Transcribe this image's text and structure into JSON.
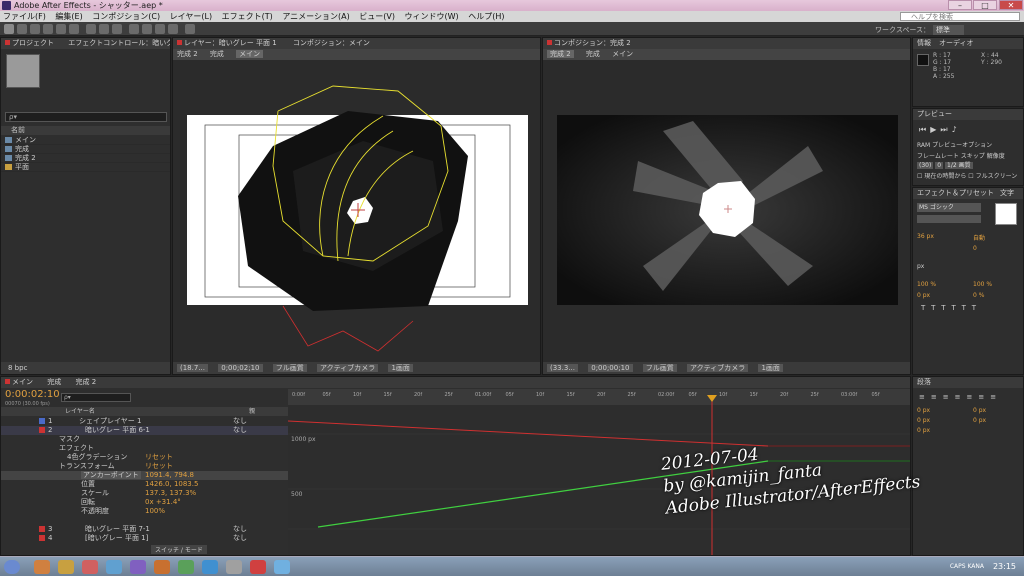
{
  "app": {
    "title": "Adobe After Effects - シャッター.aep *"
  },
  "window_controls": {
    "minimize": "–",
    "maximize": "□",
    "close": "✕"
  },
  "menu": [
    "ファイル(F)",
    "編集(E)",
    "コンポジション(C)",
    "レイヤー(L)",
    "エフェクト(T)",
    "アニメーション(A)",
    "ビュー(V)",
    "ウィンドウ(W)",
    "ヘルプ(H)"
  ],
  "search_help": {
    "placeholder": "ヘルプを検索"
  },
  "workspace": {
    "label": "ワークスペース：",
    "value": "標準"
  },
  "project_panel": {
    "tab_label": "プロジェクト",
    "effect_controls_tab": "エフェクトコントロール：暗いグレー",
    "search_placeholder": "ρ▾",
    "column_name": "名前",
    "items": [
      "メイン",
      "完成",
      "完成 2",
      "平面"
    ],
    "bpc": "8 bpc"
  },
  "layer_viewer": {
    "tab_label": "レイヤー：暗いグレー 平面 1",
    "comp_tab_label": "コンポジション：メイン",
    "breadcrumbs": [
      "完成 2",
      "完成",
      "メイン"
    ],
    "footer": {
      "zoom": "(18.7...",
      "timecode": "0;00;02;10",
      "resolution": "フル画質",
      "camera": "アクティブカメラ",
      "views": "1画面"
    }
  },
  "comp_viewer": {
    "tab_label": "コンポジション：完成 2",
    "breadcrumbs": [
      "完成 2",
      "完成",
      "メイン"
    ],
    "footer": {
      "zoom": "(33.3...",
      "timecode": "0;00;00;10",
      "resolution": "フル画質",
      "camera": "アクティブカメラ",
      "views": "1画面"
    }
  },
  "info_panel": {
    "tab_info": "情報",
    "tab_audio": "オーディオ",
    "r": "R : 17",
    "g": "G : 17",
    "b": "B : 17",
    "a": "A : 255",
    "x": "X : 44",
    "y": "Y : 290"
  },
  "preview_panel": {
    "tab_label": "プレビュー",
    "ram_options": "RAM プレビューオプション",
    "framerate_label": "フレームレート",
    "skip_label": "スキップ",
    "resolution_label": "解像度",
    "framerate_value": "(30)",
    "skip_value": "0",
    "resolution_value": "1/2 画質",
    "from_current": "現在の時間から",
    "fullscreen": "フルスクリーン"
  },
  "effects_panel": {
    "tab_label": "エフェクト＆プリセット",
    "char_tab": "文字",
    "font": "MS ゴシック",
    "size": "36 px",
    "auto": "自動",
    "tracking": "0",
    "unit": "px",
    "scale_h": "100 %",
    "scale_v": "100 %",
    "baseline": "0 px",
    "tsume": "0 %"
  },
  "paragraph_panel": {
    "tab_label": "段落",
    "indents": [
      "0 px",
      "0 px",
      "0 px",
      "0 px",
      "0 px"
    ]
  },
  "timeline": {
    "tabs": [
      "メイン",
      "完成",
      "完成 2"
    ],
    "timecode": "0:00:02:10",
    "fps": "00070 (30.00 fps)",
    "search_placeholder": "ρ▾",
    "column_name": "レイヤー名",
    "parent_label": "親",
    "layers": [
      {
        "num": "1",
        "name": "シェイプレイヤー 1",
        "parent": "なし"
      },
      {
        "num": "2",
        "name": "暗いグレー 平面 6-1",
        "parent": "なし"
      }
    ],
    "props": [
      "マスク",
      "エフェクト",
      "4色グラデーション",
      "トランスフォーム",
      "アンカーポイント",
      "位置",
      "スケール",
      "回転",
      "不透明度"
    ],
    "prop_values": [
      "リセット",
      "リセット",
      "1091.4, 794.8",
      "1426.0, 1083.5",
      "137.3, 137.3%",
      "0x +31.4°",
      "100%"
    ],
    "bottom_layers": [
      {
        "num": "3",
        "name": "暗いグレー 平面 7-1",
        "parent": "なし"
      },
      {
        "num": "4",
        "name": "[暗いグレー 平面 1]",
        "parent": "なし"
      }
    ],
    "switch_mode": "スイッチ / モード",
    "graph_labels": [
      "1000 px",
      "500"
    ],
    "ruler": [
      "0:00f",
      "05f",
      "10f",
      "15f",
      "20f",
      "25f",
      "01:00f",
      "05f",
      "10f",
      "15f",
      "20f",
      "25f",
      "02:00f",
      "05f",
      "10f",
      "15f",
      "20f",
      "25f",
      "03:00f",
      "05f"
    ]
  },
  "watermark": {
    "line1": "2012-07-04",
    "line2": "by @kamijin_fanta",
    "line3": "Adobe Illustrator/AfterEffects"
  },
  "taskbar": {
    "time": "23:15",
    "lang": "CAPS KANA"
  },
  "colors": {
    "selection_yellow": "#e8e030",
    "red_path": "#d03030",
    "green_curve": "#40d040",
    "playhead": "#e0a020"
  }
}
